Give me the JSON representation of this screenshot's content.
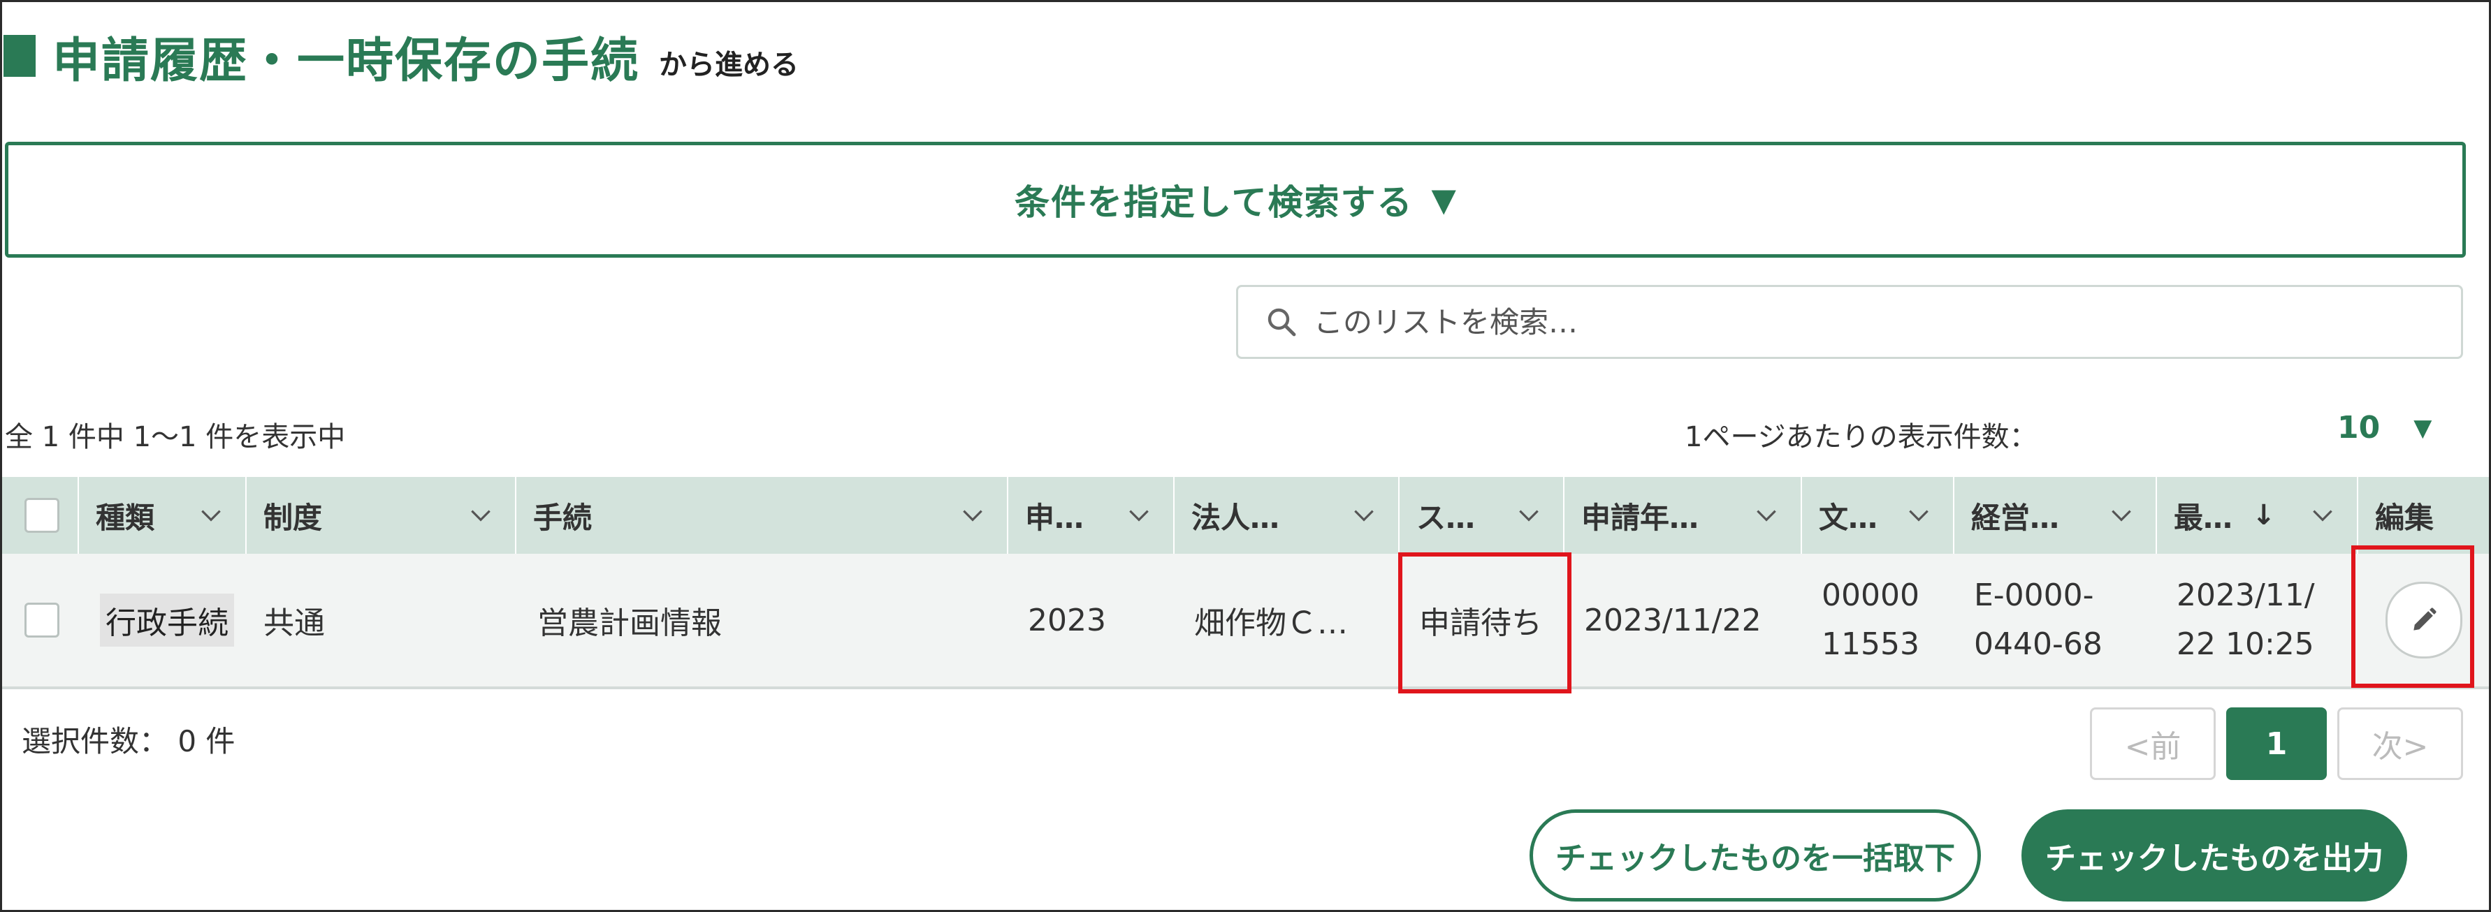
{
  "colors": {
    "accent": "#2a7a55",
    "header_bg": "#d3e3dc",
    "row_bg": "#f2f4f3",
    "highlight": "#e0151c"
  },
  "page": {
    "title": "申請履歴・一時保存の手続",
    "subtitle": "から進める"
  },
  "search_toggle": {
    "label": "条件を指定して検索する",
    "arrow": "▼"
  },
  "list_search": {
    "placeholder": "このリストを検索…",
    "icon": "search-icon"
  },
  "summary": {
    "text": "全 1 件中 1〜1 件を表示中"
  },
  "per_page": {
    "label": "1ページあたりの表示件数：",
    "value": "10",
    "caret": "▼"
  },
  "table": {
    "columns": [
      "種類",
      "制度",
      "手続",
      "申…",
      "法人…",
      "ス…",
      "申請年…",
      "文…",
      "経営…",
      "最…",
      "編集"
    ],
    "sort_indicator": "↓",
    "rows": [
      {
        "type": "行政手続",
        "system": "共通",
        "procedure": "営農計画情報",
        "year": "2023",
        "corp": "畑作物Ｃ…",
        "status": "申請待ち",
        "date": "2023/11/22",
        "doc_line1": "00000",
        "doc_line2": "11553",
        "mgmt_line1": "E-0000-",
        "mgmt_line2": "0440-68",
        "updated_line1": "2023/11/",
        "updated_line2": "22 10:25",
        "edit_icon": "pencil-icon"
      }
    ]
  },
  "selected": {
    "text": "選択件数： 0 件"
  },
  "pager": {
    "prev": "<前",
    "current": "1",
    "next": "次>"
  },
  "actions": {
    "bulk_withdraw": "チェックしたものを一括取下",
    "export": "チェックしたものを出力"
  }
}
